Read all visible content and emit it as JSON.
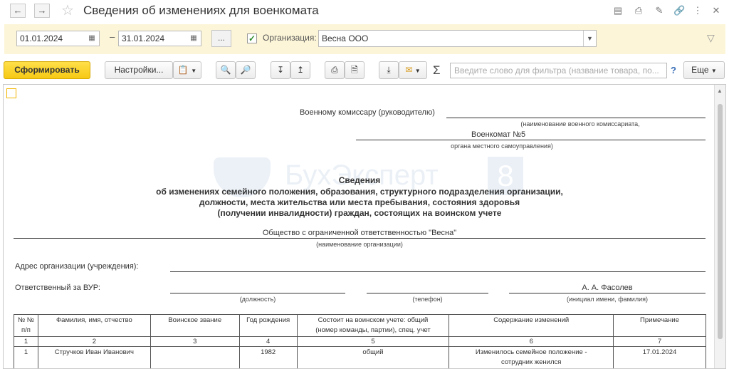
{
  "window": {
    "title": "Сведения об изменениях для военкомата",
    "back_icon": "arrow-left-icon",
    "forward_icon": "arrow-right-icon",
    "favorite_icon": "star-icon",
    "buttons": [
      "save-icon",
      "print-icon",
      "edit-icon",
      "link-icon",
      "more-vertical-icon",
      "close-icon"
    ]
  },
  "filter": {
    "date_from": "01.01.2024",
    "date_separator": "–",
    "date_to": "31.01.2024",
    "period_button": "...",
    "organization_checked": true,
    "organization_label": "Организация:",
    "organization_value": "Весна ООО"
  },
  "toolbar": {
    "generate_label": "Сформировать",
    "settings_label": "Настройки...",
    "search_placeholder": "Введите слово для фильтра (название товара, по...",
    "help_label": "?",
    "more_label": "Еще",
    "sigma": "Σ"
  },
  "report": {
    "watermark_text": "БухЭксперт",
    "watermark_number": "8",
    "addressee_label": "Военному комиссару (руководителю)",
    "commissariat_caption": "(наименование военного комиссариата,",
    "commissariat_value": "Военкомат №5",
    "local_gov_caption": "органа местного самоуправления)",
    "heading_line1": "Сведения",
    "heading_line2": "об изменениях семейного положения, образования, структурного подразделения организации,",
    "heading_line3": "должности, места жительства или места пребывания, состояния здоровья",
    "heading_line4": "(получении инвалидности) граждан, состоящих на воинском учете",
    "org_name": "Общество с ограниченной ответственностью \"Весна\"",
    "org_caption": "(наименование организации)",
    "address_label": "Адрес организации (учреждения):",
    "responsible_label": "Ответственный за ВУР:",
    "position_caption": "(должность)",
    "phone_caption": "(телефон)",
    "responsible_name": "А. А. Фасолев",
    "name_caption": "(инициал имени, фамилия)",
    "table": {
      "headers": [
        "№ №\nп/п",
        "Фамилия, имя, отчество",
        "Воинское звание",
        "Год рождения",
        "Состоит на воинском учете: общий\n(номер команды, партии), спец. учет",
        "Содержание изменений",
        "Примечание"
      ],
      "column_numbers": [
        "1",
        "2",
        "3",
        "4",
        "5",
        "6",
        "7"
      ],
      "rows": [
        [
          "1",
          "Стручков Иван Иванович",
          "",
          "1982",
          "общий",
          "Изменилось семейное положение -\nсотрудник женился",
          "17.01.2024"
        ]
      ]
    }
  }
}
